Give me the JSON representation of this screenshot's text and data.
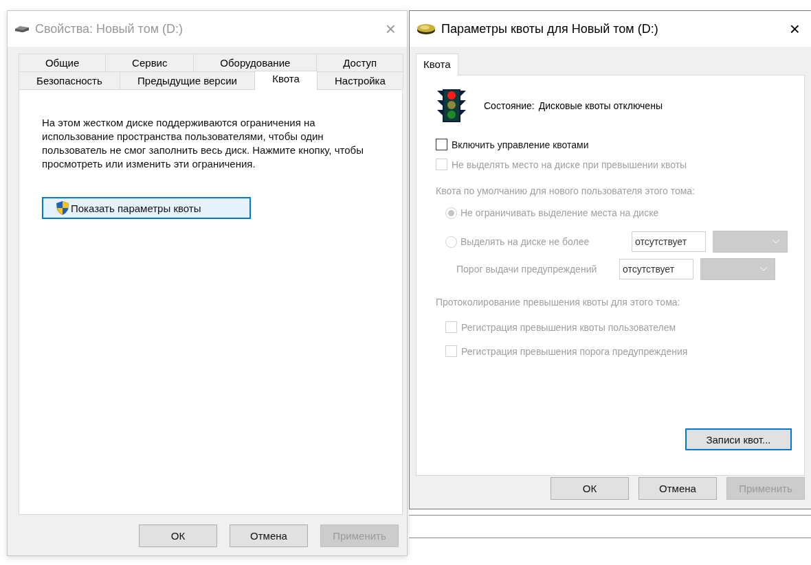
{
  "properties_window": {
    "title": "Свойства: Новый том (D:)",
    "close": "×",
    "tab_rows": [
      [
        {
          "label": "Общие",
          "selected": false
        },
        {
          "label": "Сервис",
          "selected": false
        },
        {
          "label": "Оборудование",
          "selected": false
        },
        {
          "label": "Доступ",
          "selected": false
        }
      ],
      [
        {
          "label": "Безопасность",
          "selected": false
        },
        {
          "label": "Предыдущие версии",
          "selected": false
        },
        {
          "label": "Квота",
          "selected": true
        },
        {
          "label": "Настройка",
          "selected": false
        }
      ]
    ],
    "description": "На этом жестком диске поддерживаются ограничения на использование пространства пользователями, чтобы один пользователь не смог заполнить весь диск. Нажмите кнопку, чтобы просмотреть или изменить эти ограничения.",
    "show_button": {
      "label": "Показать параметры квоты",
      "focused": true
    },
    "buttons": [
      {
        "label": "ОК",
        "disabled": false
      },
      {
        "label": "Отмена",
        "disabled": false
      },
      {
        "label": "Применить",
        "disabled": true
      }
    ]
  },
  "quota_window": {
    "title": "Параметры квоты для Новый том (D:)",
    "close": "×",
    "tabs": [
      {
        "label": "Квота",
        "selected": true
      }
    ],
    "status_label": "Состояние:",
    "status_value": "Дисковые квоты отключены",
    "checkboxes": [
      {
        "label": "Включить управление квотами",
        "checked": false,
        "disabled": false
      },
      {
        "label": "Не выделять место на диске при превышении квоты",
        "checked": false,
        "disabled": true
      }
    ],
    "default_quota_label": "Квота по умолчанию для нового пользователя этого тома:",
    "radios": [
      {
        "label": "Не ограничивать выделение места на диске",
        "selected": true,
        "disabled": true
      },
      {
        "label": "Выделять на диске не более",
        "selected": false,
        "disabled": true,
        "value": "отсутствует"
      }
    ],
    "warning": {
      "label": "Порог выдачи предупреждений",
      "value": "отсутствует",
      "disabled": true
    },
    "logging_label": "Протоколирование превышения квоты для этого тома:",
    "logging_checkboxes": [
      {
        "label": "Регистрация превышения квоты пользователем",
        "checked": false,
        "disabled": true
      },
      {
        "label": "Регистрация превышения порога предупреждения",
        "checked": false,
        "disabled": true
      }
    ],
    "entries_button": {
      "label": "Записи квот...",
      "focused": true
    },
    "buttons": [
      {
        "label": "ОК",
        "disabled": false
      },
      {
        "label": "Отмена",
        "disabled": false
      },
      {
        "label": "Применить",
        "disabled": true
      }
    ]
  }
}
